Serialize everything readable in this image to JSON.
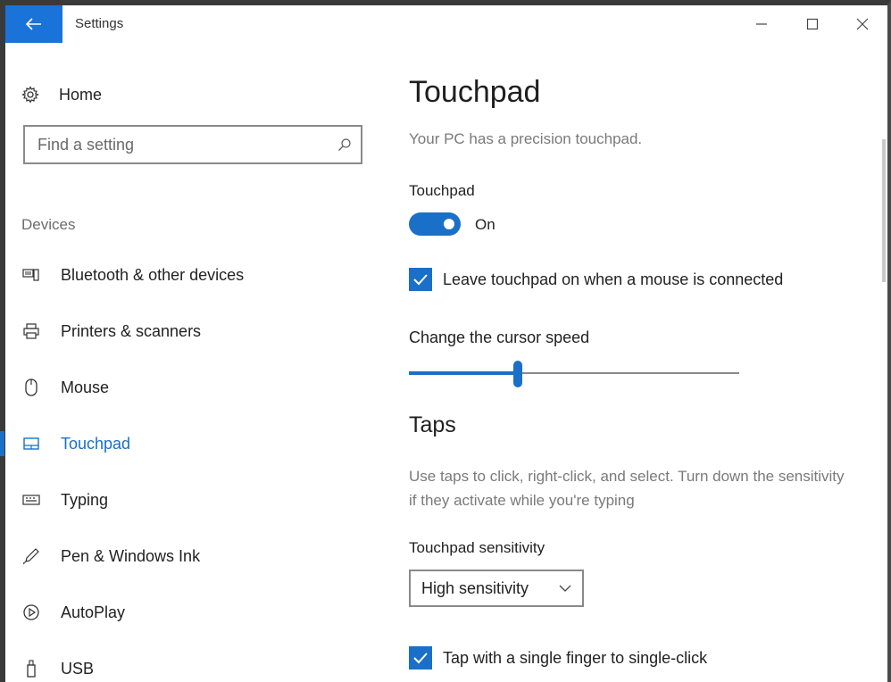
{
  "window": {
    "title": "Settings"
  },
  "sidebar": {
    "home_label": "Home",
    "search_placeholder": "Find a setting",
    "section_label": "Devices",
    "items": [
      {
        "label": "Bluetooth & other devices",
        "icon": "bluetooth-devices-icon"
      },
      {
        "label": "Printers & scanners",
        "icon": "printer-icon"
      },
      {
        "label": "Mouse",
        "icon": "mouse-icon"
      },
      {
        "label": "Touchpad",
        "icon": "touchpad-icon",
        "active": true
      },
      {
        "label": "Typing",
        "icon": "keyboard-icon"
      },
      {
        "label": "Pen & Windows Ink",
        "icon": "pen-icon"
      },
      {
        "label": "AutoPlay",
        "icon": "autoplay-icon"
      },
      {
        "label": "USB",
        "icon": "usb-icon"
      }
    ]
  },
  "content": {
    "title": "Touchpad",
    "subtitle": "Your PC has a precision touchpad.",
    "toggle_heading": "Touchpad",
    "toggle_state": "On",
    "checkbox_leave_on": "Leave touchpad on when a mouse is connected",
    "cursor_speed_heading": "Change the cursor speed",
    "cursor_speed_level": 0.33,
    "taps_heading": "Taps",
    "taps_description": "Use taps to click, right-click, and select. Turn down the sensitivity if they activate while you're typing",
    "sensitivity_heading": "Touchpad sensitivity",
    "sensitivity_value": "High sensitivity",
    "checkbox_single_tap": "Tap with a single finger to single-click"
  },
  "colors": {
    "accent": "#1a6fc8",
    "back_button": "#1a73d9"
  }
}
